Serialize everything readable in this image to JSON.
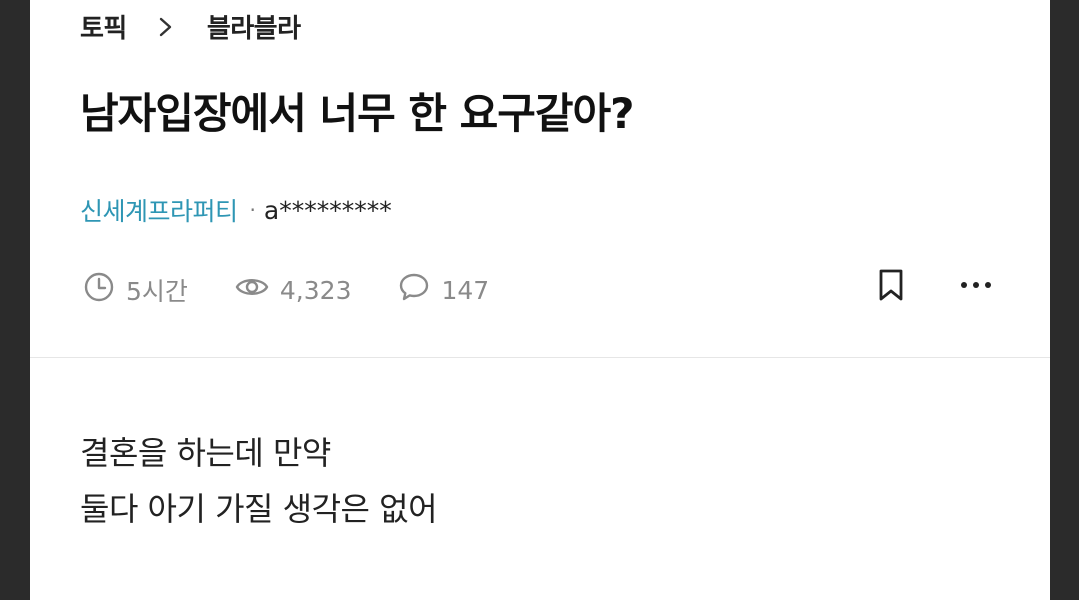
{
  "breadcrumb": {
    "root": "토픽",
    "current": "블라블라"
  },
  "post": {
    "title": "남자입장에서 너무 한 요구같아?",
    "company": "신세계프라퍼티",
    "separator": "·",
    "nickname": "a*********",
    "time_ago": "5시간",
    "views": "4,323",
    "comments": "147",
    "body_lines": [
      "결혼을 하는데 만약",
      "둘다 아기 가질 생각은 없어"
    ]
  },
  "icons": {
    "chevron": "chevron-right-icon",
    "clock": "clock-icon",
    "eye": "eye-icon",
    "comment": "comment-icon",
    "bookmark": "bookmark-icon",
    "more": "more-horizontal-icon"
  },
  "colors": {
    "company": "#2e96b4",
    "meta": "#8a8a8a",
    "text": "#222222",
    "backdrop": "#2b2b2b"
  }
}
